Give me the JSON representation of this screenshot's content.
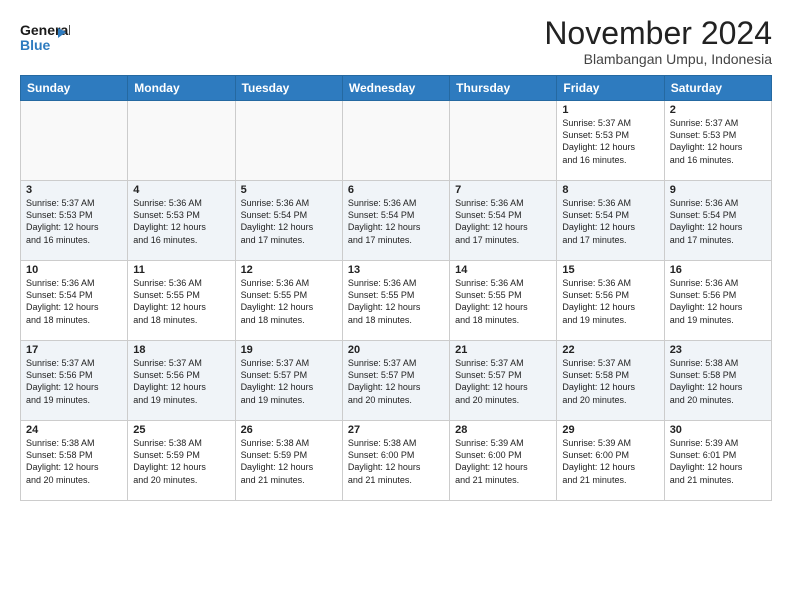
{
  "header": {
    "logo_line1": "General",
    "logo_line2": "Blue",
    "title": "November 2024",
    "subtitle": "Blambangan Umpu, Indonesia"
  },
  "weekdays": [
    "Sunday",
    "Monday",
    "Tuesday",
    "Wednesday",
    "Thursday",
    "Friday",
    "Saturday"
  ],
  "weeks": [
    [
      {
        "day": "",
        "info": ""
      },
      {
        "day": "",
        "info": ""
      },
      {
        "day": "",
        "info": ""
      },
      {
        "day": "",
        "info": ""
      },
      {
        "day": "",
        "info": ""
      },
      {
        "day": "1",
        "info": "Sunrise: 5:37 AM\nSunset: 5:53 PM\nDaylight: 12 hours\nand 16 minutes."
      },
      {
        "day": "2",
        "info": "Sunrise: 5:37 AM\nSunset: 5:53 PM\nDaylight: 12 hours\nand 16 minutes."
      }
    ],
    [
      {
        "day": "3",
        "info": "Sunrise: 5:37 AM\nSunset: 5:53 PM\nDaylight: 12 hours\nand 16 minutes."
      },
      {
        "day": "4",
        "info": "Sunrise: 5:36 AM\nSunset: 5:53 PM\nDaylight: 12 hours\nand 16 minutes."
      },
      {
        "day": "5",
        "info": "Sunrise: 5:36 AM\nSunset: 5:54 PM\nDaylight: 12 hours\nand 17 minutes."
      },
      {
        "day": "6",
        "info": "Sunrise: 5:36 AM\nSunset: 5:54 PM\nDaylight: 12 hours\nand 17 minutes."
      },
      {
        "day": "7",
        "info": "Sunrise: 5:36 AM\nSunset: 5:54 PM\nDaylight: 12 hours\nand 17 minutes."
      },
      {
        "day": "8",
        "info": "Sunrise: 5:36 AM\nSunset: 5:54 PM\nDaylight: 12 hours\nand 17 minutes."
      },
      {
        "day": "9",
        "info": "Sunrise: 5:36 AM\nSunset: 5:54 PM\nDaylight: 12 hours\nand 17 minutes."
      }
    ],
    [
      {
        "day": "10",
        "info": "Sunrise: 5:36 AM\nSunset: 5:54 PM\nDaylight: 12 hours\nand 18 minutes."
      },
      {
        "day": "11",
        "info": "Sunrise: 5:36 AM\nSunset: 5:55 PM\nDaylight: 12 hours\nand 18 minutes."
      },
      {
        "day": "12",
        "info": "Sunrise: 5:36 AM\nSunset: 5:55 PM\nDaylight: 12 hours\nand 18 minutes."
      },
      {
        "day": "13",
        "info": "Sunrise: 5:36 AM\nSunset: 5:55 PM\nDaylight: 12 hours\nand 18 minutes."
      },
      {
        "day": "14",
        "info": "Sunrise: 5:36 AM\nSunset: 5:55 PM\nDaylight: 12 hours\nand 18 minutes."
      },
      {
        "day": "15",
        "info": "Sunrise: 5:36 AM\nSunset: 5:56 PM\nDaylight: 12 hours\nand 19 minutes."
      },
      {
        "day": "16",
        "info": "Sunrise: 5:36 AM\nSunset: 5:56 PM\nDaylight: 12 hours\nand 19 minutes."
      }
    ],
    [
      {
        "day": "17",
        "info": "Sunrise: 5:37 AM\nSunset: 5:56 PM\nDaylight: 12 hours\nand 19 minutes."
      },
      {
        "day": "18",
        "info": "Sunrise: 5:37 AM\nSunset: 5:56 PM\nDaylight: 12 hours\nand 19 minutes."
      },
      {
        "day": "19",
        "info": "Sunrise: 5:37 AM\nSunset: 5:57 PM\nDaylight: 12 hours\nand 19 minutes."
      },
      {
        "day": "20",
        "info": "Sunrise: 5:37 AM\nSunset: 5:57 PM\nDaylight: 12 hours\nand 20 minutes."
      },
      {
        "day": "21",
        "info": "Sunrise: 5:37 AM\nSunset: 5:57 PM\nDaylight: 12 hours\nand 20 minutes."
      },
      {
        "day": "22",
        "info": "Sunrise: 5:37 AM\nSunset: 5:58 PM\nDaylight: 12 hours\nand 20 minutes."
      },
      {
        "day": "23",
        "info": "Sunrise: 5:38 AM\nSunset: 5:58 PM\nDaylight: 12 hours\nand 20 minutes."
      }
    ],
    [
      {
        "day": "24",
        "info": "Sunrise: 5:38 AM\nSunset: 5:58 PM\nDaylight: 12 hours\nand 20 minutes."
      },
      {
        "day": "25",
        "info": "Sunrise: 5:38 AM\nSunset: 5:59 PM\nDaylight: 12 hours\nand 20 minutes."
      },
      {
        "day": "26",
        "info": "Sunrise: 5:38 AM\nSunset: 5:59 PM\nDaylight: 12 hours\nand 21 minutes."
      },
      {
        "day": "27",
        "info": "Sunrise: 5:38 AM\nSunset: 6:00 PM\nDaylight: 12 hours\nand 21 minutes."
      },
      {
        "day": "28",
        "info": "Sunrise: 5:39 AM\nSunset: 6:00 PM\nDaylight: 12 hours\nand 21 minutes."
      },
      {
        "day": "29",
        "info": "Sunrise: 5:39 AM\nSunset: 6:00 PM\nDaylight: 12 hours\nand 21 minutes."
      },
      {
        "day": "30",
        "info": "Sunrise: 5:39 AM\nSunset: 6:01 PM\nDaylight: 12 hours\nand 21 minutes."
      }
    ]
  ]
}
